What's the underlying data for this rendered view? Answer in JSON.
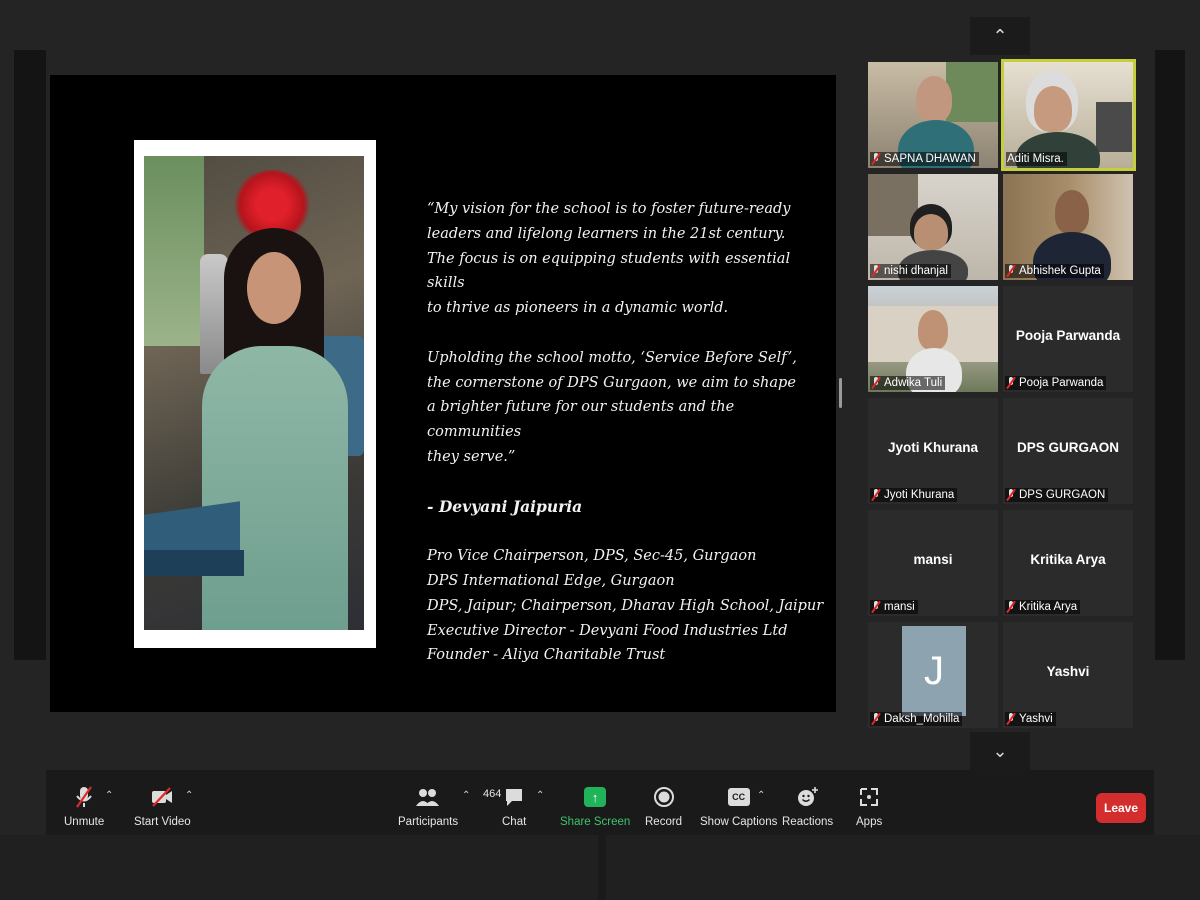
{
  "share": {
    "quote_lines_1": [
      "“My vision for the school is to foster future-ready",
      "leaders and lifelong learners in the 21st century.",
      "The focus is on equipping students with essential skills",
      "to thrive as pioneers in a dynamic world."
    ],
    "quote_lines_2": [
      "Upholding the school motto, ‘Service Before Self’,",
      "the cornerstone of DPS Gurgaon, we aim to shape",
      "a brighter future for our students and the communities",
      "they serve.”"
    ],
    "author": "- Devyani Jaipuria",
    "roles": [
      "Pro Vice Chairperson, DPS, Sec-45, Gurgaon",
      "DPS International Edge, Gurgaon",
      "DPS, Jaipur; Chairperson, Dharav High School, Jaipur",
      "Executive Director - Devyani Food Industries Ltd",
      "Founder - Aliya Charitable Trust"
    ]
  },
  "gallery": {
    "up_icon": "chevron-up-icon",
    "down_icon": "chevron-down-icon",
    "participants": [
      {
        "name": "SAPNA DHAWAN",
        "video": true
      },
      {
        "name": "Aditi Misra.",
        "video": true,
        "active": true
      },
      {
        "name": "nishi dhanjal",
        "video": true
      },
      {
        "name": "Abhishek Gupta",
        "video": true
      },
      {
        "name": "Adwika Tuli",
        "video": true
      },
      {
        "name": "Pooja Parwanda",
        "video": false
      },
      {
        "name": "Jyoti Khurana",
        "video": false
      },
      {
        "name": "DPS GURGAON",
        "video": false
      },
      {
        "name": "mansi",
        "video": false
      },
      {
        "name": "Kritika Arya",
        "video": false
      },
      {
        "name": "Daksh_Mohilla",
        "video": false,
        "avatar_letter": "J"
      },
      {
        "name": "Yashvi",
        "video": false
      }
    ]
  },
  "toolbar": {
    "unmute": "Unmute",
    "start_video": "Start Video",
    "participants": "Participants",
    "participants_count": "464",
    "chat": "Chat",
    "share_screen": "Share Screen",
    "record": "Record",
    "show_captions": "Show Captions",
    "reactions": "Reactions",
    "apps": "Apps",
    "leave": "Leave",
    "cc": "CC"
  },
  "colors": {
    "active_border": "#c4cf3b",
    "share_green": "#20b359",
    "leave_red": "#d42d2d"
  }
}
